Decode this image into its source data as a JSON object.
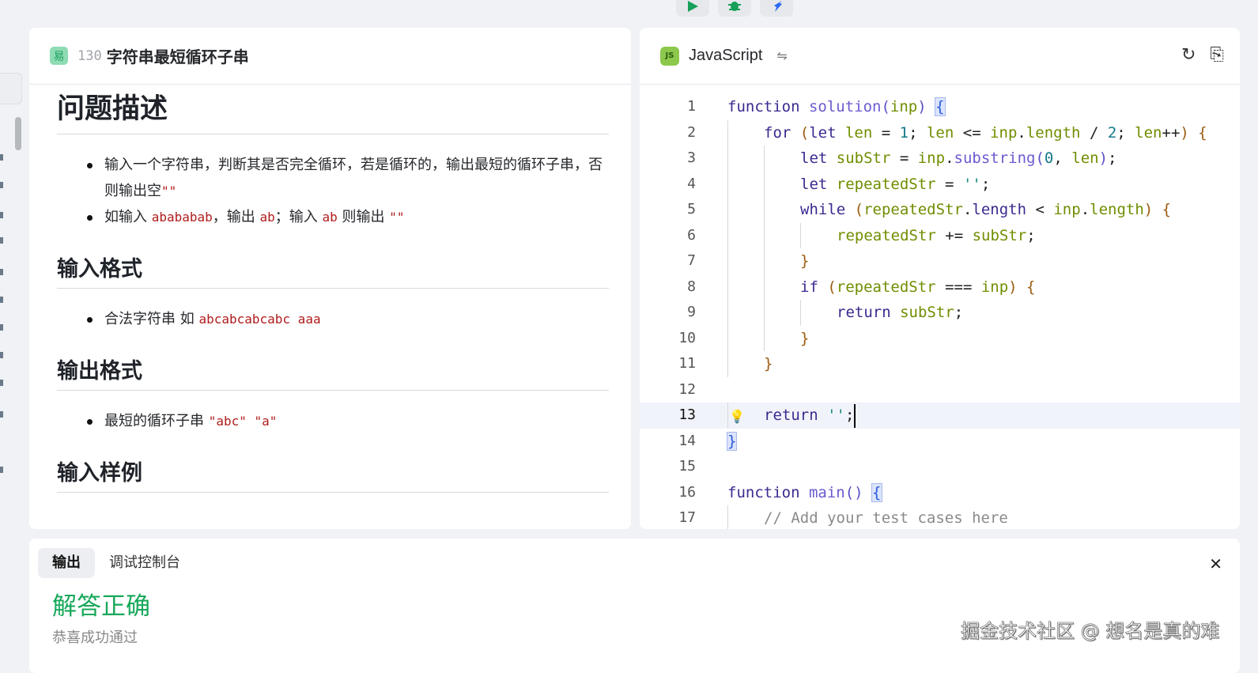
{
  "toolbar": {
    "buttons": [
      {
        "icon": "play-icon",
        "color": "#18a058"
      },
      {
        "icon": "bug-icon",
        "color": "#18a058"
      },
      {
        "icon": "rocket-icon",
        "color": "#2a6bf2"
      }
    ]
  },
  "problem": {
    "difficulty": "易",
    "number": "130",
    "title": "字符串最短循环子串",
    "sections": {
      "desc_title": "问题描述",
      "desc_items": [
        [
          {
            "t": "输入一个字符串，判断其是否完全循环，若是循环的，输出最短的循环子串，否则输出空"
          },
          {
            "c": "\"\""
          }
        ],
        [
          {
            "t": "如输入 "
          },
          {
            "c": "abababab"
          },
          {
            "t": "，输出 "
          },
          {
            "c": "ab"
          },
          {
            "t": "；输入 "
          },
          {
            "c": "ab"
          },
          {
            "t": " 则输出 "
          },
          {
            "c": "\"\""
          }
        ]
      ],
      "input_title": "输入格式",
      "input_items": [
        [
          {
            "t": "合法字符串 如 "
          },
          {
            "c": "abcabcabcabc aaa"
          }
        ]
      ],
      "output_title": "输出格式",
      "output_items": [
        [
          {
            "t": "最短的循环子串 "
          },
          {
            "c": "\"abc\" \"a\""
          }
        ]
      ],
      "sample_title": "输入样例"
    }
  },
  "editor": {
    "language": "JavaScript",
    "active_line": 13,
    "lines": [
      [
        [
          "kw",
          "function "
        ],
        [
          "fn",
          "solution"
        ],
        [
          "pr",
          "("
        ],
        [
          "id",
          "inp"
        ],
        [
          "pr",
          ") "
        ],
        [
          "bb",
          "{"
        ]
      ],
      [
        [
          "kw",
          "for "
        ],
        [
          "br",
          "("
        ],
        [
          "kw",
          "let "
        ],
        [
          "id",
          "len"
        ],
        [
          "pn",
          " = "
        ],
        [
          "nm",
          "1"
        ],
        [
          "pn",
          "; "
        ],
        [
          "id",
          "len"
        ],
        [
          "pn",
          " <= "
        ],
        [
          "id",
          "inp"
        ],
        [
          "pn",
          "."
        ],
        [
          "id",
          "length"
        ],
        [
          "pn",
          " / "
        ],
        [
          "nm",
          "2"
        ],
        [
          "pn",
          "; "
        ],
        [
          "id",
          "len"
        ],
        [
          "pn",
          "++"
        ],
        [
          "br",
          ") "
        ],
        [
          "br",
          "{"
        ]
      ],
      [
        [
          "kw",
          "let "
        ],
        [
          "id",
          "subStr"
        ],
        [
          "pn",
          " = "
        ],
        [
          "id",
          "inp"
        ],
        [
          "pn",
          "."
        ],
        [
          "fn",
          "substring"
        ],
        [
          "pr",
          "("
        ],
        [
          "nm",
          "0"
        ],
        [
          "pn",
          ", "
        ],
        [
          "id",
          "len"
        ],
        [
          "pr",
          ")"
        ],
        [
          "pn",
          ";"
        ]
      ],
      [
        [
          "kw",
          "let "
        ],
        [
          "id",
          "repeatedStr"
        ],
        [
          "pn",
          " = "
        ],
        [
          "st",
          "''"
        ],
        [
          "pn",
          ";"
        ]
      ],
      [
        [
          "kw",
          "while "
        ],
        [
          "br",
          "("
        ],
        [
          "id",
          "repeatedStr"
        ],
        [
          "pn",
          "."
        ],
        [
          "kw",
          "length"
        ],
        [
          "pn",
          " < "
        ],
        [
          "id",
          "inp"
        ],
        [
          "pn",
          "."
        ],
        [
          "id",
          "length"
        ],
        [
          "br",
          ") {"
        ]
      ],
      [
        [
          "id",
          "repeatedStr"
        ],
        [
          "pn",
          " += "
        ],
        [
          "id",
          "subStr"
        ],
        [
          "pn",
          ";"
        ]
      ],
      [
        [
          "br",
          "}"
        ]
      ],
      [
        [
          "kw",
          "if "
        ],
        [
          "br",
          "("
        ],
        [
          "id",
          "repeatedStr"
        ],
        [
          "pn",
          " === "
        ],
        [
          "id",
          "inp"
        ],
        [
          "br",
          ") {"
        ]
      ],
      [
        [
          "kw",
          "return "
        ],
        [
          "id",
          "subStr"
        ],
        [
          "pn",
          ";"
        ]
      ],
      [
        [
          "br",
          "}"
        ]
      ],
      [
        [
          "br",
          "}"
        ]
      ],
      [],
      [
        [
          "kw",
          "return "
        ],
        [
          "st",
          "''"
        ],
        [
          "pn",
          ";"
        ]
      ],
      [
        [
          "bb",
          "}"
        ]
      ],
      [],
      [
        [
          "kw",
          "function "
        ],
        [
          "fn",
          "main"
        ],
        [
          "pr",
          "() "
        ],
        [
          "bb",
          "{"
        ]
      ],
      [
        [
          "cm",
          "// Add your test cases here"
        ]
      ]
    ],
    "indents": [
      0,
      1,
      2,
      2,
      2,
      3,
      2,
      2,
      3,
      2,
      1,
      0,
      1,
      0,
      0,
      0,
      1
    ]
  },
  "output": {
    "tabs": [
      "输出",
      "调试控制台"
    ],
    "active_tab": "输出",
    "result": "解答正确",
    "message": "恭喜成功通过"
  },
  "watermark": "掘金技术社区 @ 想名是真的难"
}
